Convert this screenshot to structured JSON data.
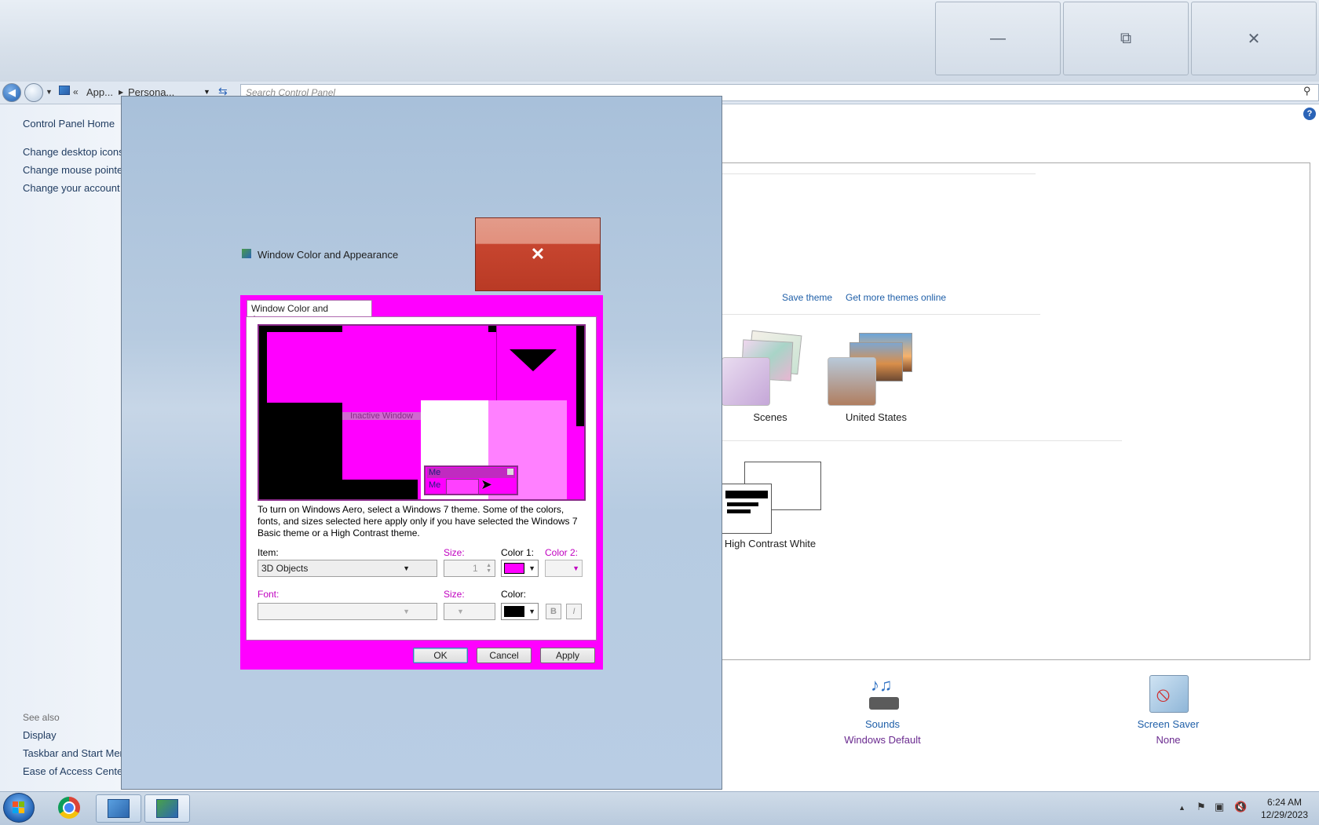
{
  "window": {
    "caption_buttons": {
      "minimize": "—",
      "restore": "⧉",
      "close": "✕"
    }
  },
  "address": {
    "crumb1": "App...",
    "crumb2": "Persona...",
    "search_placeholder": "Search Control Panel"
  },
  "sidebar": {
    "home": "Control Panel Home",
    "items": [
      "Change desktop icons",
      "Change mouse pointers",
      "Change your account p"
    ],
    "see_also_title": "See also",
    "see_also": [
      "Display",
      "Taskbar and Start Menu",
      "Ease of Access Center"
    ]
  },
  "themes": {
    "save_theme": "Save theme",
    "more_online": "Get more themes online",
    "items": [
      "Scenes",
      "United States",
      "High Contrast White"
    ]
  },
  "bottom": {
    "sounds_title": "Sounds",
    "sounds_value": "Windows Default",
    "saver_title": "Screen Saver",
    "saver_value": "None"
  },
  "dialog": {
    "window_title": "Window Color and Appearance",
    "tab": "Window Color and Appearance",
    "preview": {
      "inactive_title": "Inactive Window",
      "msg1": "Me",
      "msg2": "Me"
    },
    "info": "To turn on Windows Aero, select a Windows 7 theme.  Some of the colors, fonts, and sizes selected here apply only if you have selected the Windows 7 Basic theme or a High Contrast theme.",
    "item_label": "Item:",
    "item_value": "3D Objects",
    "size_label": "Size:",
    "size_value": "1",
    "color1_label": "Color 1:",
    "color2_label": "Color 2:",
    "font_label": "Font:",
    "font_size_label": "Size:",
    "font_color_label": "Color:",
    "bold": "B",
    "italic": "I",
    "ok": "OK",
    "cancel": "Cancel",
    "apply": "Apply",
    "colors": {
      "magenta": "#ff00ff",
      "black": "#000000"
    }
  },
  "taskbar": {
    "time": "6:24 AM",
    "date": "12/29/2023"
  }
}
